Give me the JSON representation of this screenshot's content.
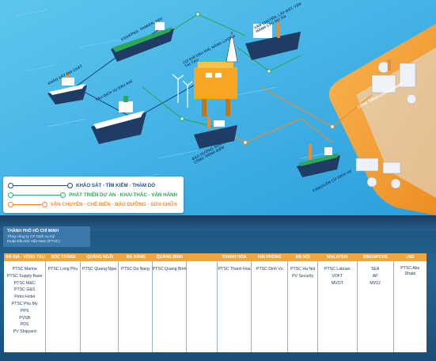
{
  "labels": {
    "khao_sat_dia_chat": "Khảo sát địa chất",
    "fso": "FSO/FPSO, Tanker, FSU",
    "tau_dich_vu": "Tàu dịch vụ dầu khí",
    "co_khi": "Cơ khí dầu khí, năng lượng tái tạo",
    "van_chuyen_lap_dat": "Vận chuyển, lắp đặt, vận hành các dự án",
    "cong_trinh_cong_nghiep": "Công trình công nghiệp",
    "bao_duong": "Bảo dưỡng sửa chữa công trình biển",
    "cang_dich_vu": "Cảng/căn cứ dịch vụ"
  },
  "legend": [
    {
      "text": "KHẢO SÁT - TÌM KIẾM - THĂM DÒ",
      "color": "#1e4f8a"
    },
    {
      "text": "PHÁT TRIỂN DỰ ÁN - KHAI THÁC - VẬN HÀNH",
      "color": "#2fa65a"
    },
    {
      "text": "VẬN CHUYỂN - CHẾ BIẾN - BẢO DƯỠNG - SỬA CHỮA",
      "color": "#f08a2a"
    }
  ],
  "panel": {
    "hcmc_title": "THÀNH PHỐ HỒ CHÍ MINH",
    "hcmc_sub": "Tổng công ty CP Dịch vụ Kỹ thuật Dầu khí Việt Nam (PTSC)"
  },
  "columns": [
    {
      "header": "BÀ RỊA - VŨNG TÀU",
      "items": [
        "PTSC Marine",
        "PTSC Supply Base",
        "PTSC M&C",
        "PTSC G&S",
        "Petro Hotel",
        "PTSC Phu My",
        "PPS",
        "PVSB",
        "PDS",
        "PV Shipyard"
      ]
    },
    {
      "header": "SÓC TRĂNG",
      "items": [
        "PTSC Long Phu"
      ]
    },
    {
      "header": "QUẢNG NGÃI",
      "items": [
        "PTSC Quang Ngai"
      ]
    },
    {
      "header": "ĐÀ NẴNG",
      "items": [
        "PTSC Da Nang"
      ]
    },
    {
      "header": "QUẢNG BÌNH",
      "items": [
        "PTSC Quang Binh"
      ]
    },
    {
      "header": "",
      "items": []
    },
    {
      "header": "THANH HÓA",
      "items": [
        "PTSC Thanh Hoa"
      ]
    },
    {
      "header": "HẢI PHÒNG",
      "items": [
        "PTSC Dinh Vu"
      ]
    },
    {
      "header": "HÀ NỘI",
      "items": [
        "PTSC Ha Noi",
        "PV Security"
      ]
    },
    {
      "header": "MALAYSIA",
      "items": [
        "PTSC Labuan",
        "VOFT",
        "MVOT"
      ]
    },
    {
      "header": "SINGAPORE",
      "items": [
        "SEA",
        "AP",
        "MV12"
      ]
    },
    {
      "header": "UAE",
      "items": [
        "PTSC Abu Dhabi"
      ]
    }
  ],
  "colors": {
    "sea": "#41b4e6",
    "land": "#f4a23c",
    "panel": "#1f5a88",
    "header": "#f0a640"
  }
}
